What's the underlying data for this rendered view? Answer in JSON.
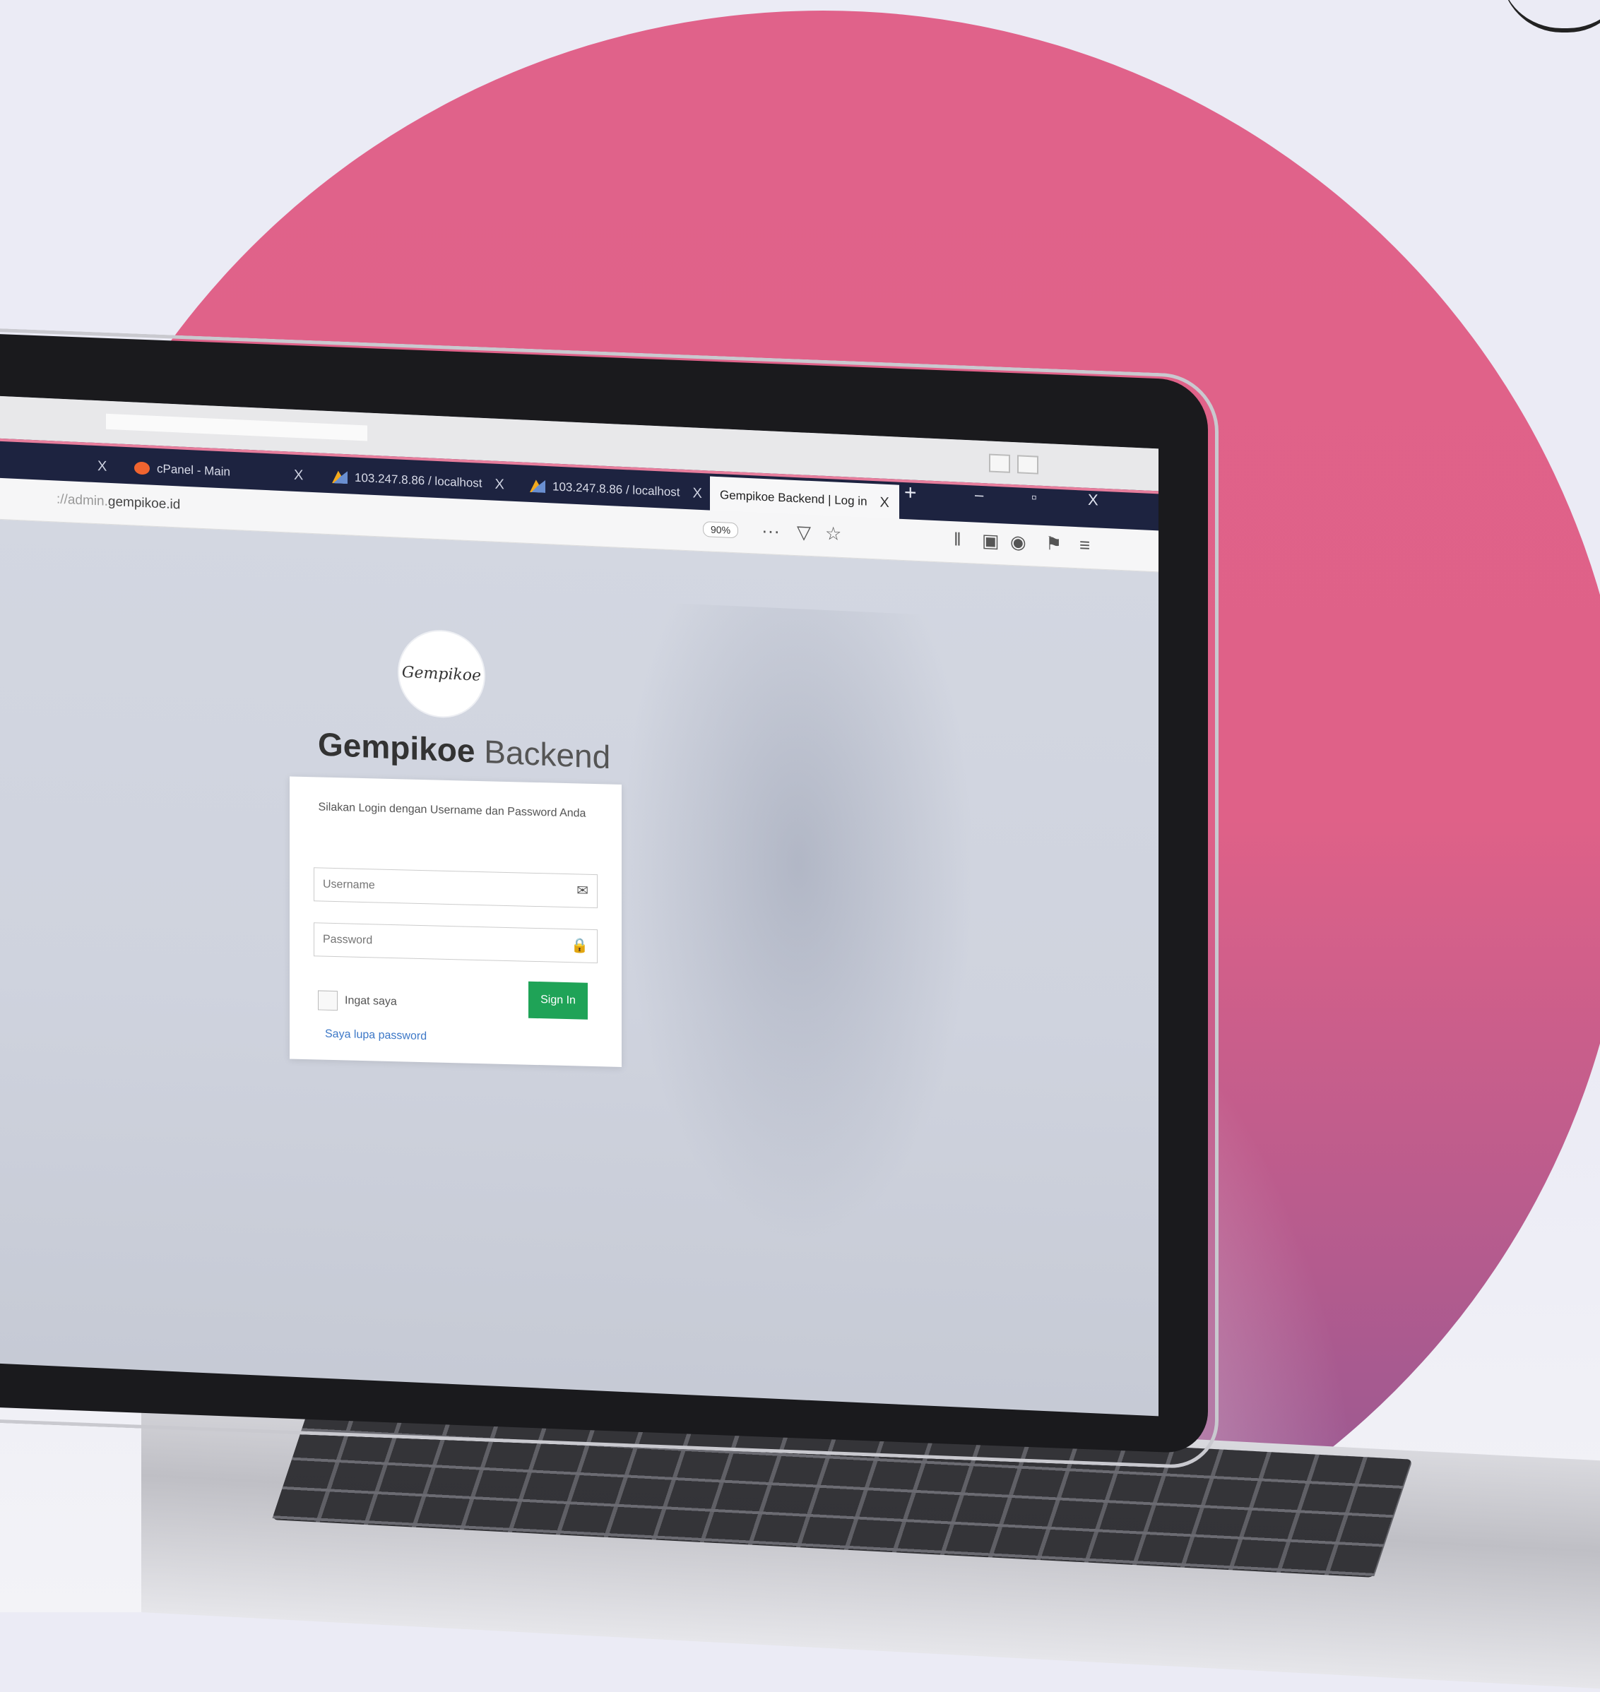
{
  "browser": {
    "tabs": [
      {
        "label": "cPanel - Main",
        "icon": "cpanel-icon"
      },
      {
        "label": "103.247.8.86 / localhost",
        "icon": "phpmyadmin-icon"
      },
      {
        "label": "103.247.8.86 / localhost",
        "icon": "phpmyadmin-icon"
      },
      {
        "label": "Gempikoe Backend | Log in",
        "active": true
      }
    ],
    "close_glyph": "X",
    "new_tab_glyph": "+",
    "window_controls": {
      "minimize": "–",
      "maximize": "▫",
      "close": "X"
    },
    "url_prefix": "://admin.",
    "url_domain": "gempikoe.id",
    "zoom": "90%",
    "menu_glyph": "···"
  },
  "page": {
    "logo_text": "Gempikoe",
    "title_bold": "Gempikoe",
    "title_light": "Backend",
    "login_message": "Silakan Login dengan Username dan Password Anda",
    "username_placeholder": "Username",
    "password_placeholder": "Password",
    "remember_label": "Ingat saya",
    "signin_label": "Sign In",
    "forgot_link": "Saya lupa password"
  },
  "colors": {
    "accent_pink": "#e0628a",
    "purple": "#8a5894",
    "tabbar": "#1d2340",
    "signin_green": "#1fa357",
    "link_blue": "#3d78c7"
  }
}
